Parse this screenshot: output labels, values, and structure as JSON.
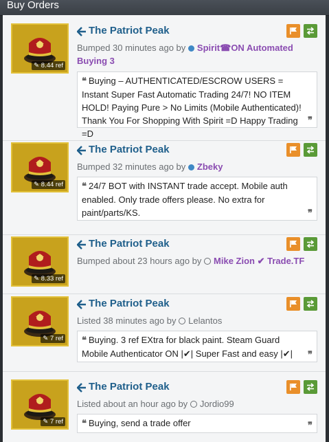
{
  "panel": {
    "title": "Buy Orders"
  },
  "colors": {
    "accent_link": "#1f5f8b",
    "user_purple": "#8a4cb1",
    "flag_orange": "#e98f2a",
    "trade_green": "#5a9a37",
    "item_gold": "#c8a21d"
  },
  "listings": [
    {
      "item_name": "The Patriot Peak",
      "price": "8.44 ref",
      "status_prefix": "Bumped 30 minutes ago by",
      "user": "Spirit☎ON Automated Buying 3",
      "user_style": "premium",
      "comment": "Buying – AUTHENTICATED/ESCROW USERS = Instant Super Fast Automatic Trading 24/7! NO ITEM HOLD! Paying Pure > No Limits (Mobile Authenticated)! Thank You For Shopping With Spirit =D Happy Trading =D"
    },
    {
      "item_name": "The Patriot Peak",
      "price": "8.44 ref",
      "status_prefix": "Bumped 32 minutes ago by",
      "user": "Zbeky",
      "user_style": "premium",
      "comment": "24/7 BOT with INSTANT trade accept. Mobile auth enabled. Only trade offers please. No extra for paint/parts/KS."
    },
    {
      "item_name": "The Patriot Peak",
      "price": "8.33 ref",
      "status_prefix": "Bumped about 23 hours ago by",
      "user": "Mike Zion ✔ Trade.TF",
      "user_style": "premium-offline",
      "comment": ""
    },
    {
      "item_name": "The Patriot Peak",
      "price": "7 ref",
      "status_prefix": "Listed 38 minutes ago by",
      "user": "Lelantos",
      "user_style": "regular",
      "comment": "Buying. 3 ref EXtra for black paint. Steam Guard Mobile Authenticator ON |✔| Super Fast and easy |✔|"
    },
    {
      "item_name": "The Patriot Peak",
      "price": "7 ref",
      "status_prefix": "Listed about an hour ago by",
      "user": "Jordio99",
      "user_style": "regular",
      "comment": "Buying, send a trade offer"
    }
  ],
  "icons": {
    "item": "patriot-peak-hat-icon",
    "price": "tag-icon",
    "back": "arrow-left-icon",
    "flag": "flag-icon",
    "trade": "exchange-icon",
    "online": "online-dot-icon",
    "offline": "offline-ring-icon",
    "quote_open": "quote-open-icon",
    "quote_close": "quote-close-icon"
  }
}
